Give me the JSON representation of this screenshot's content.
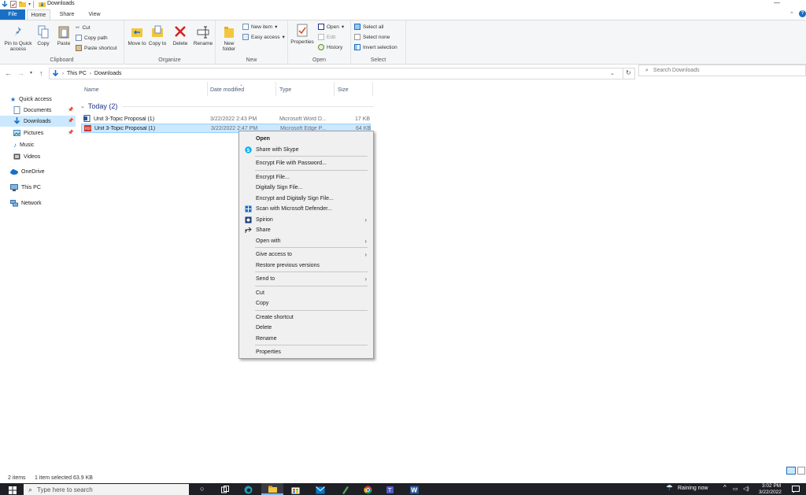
{
  "window": {
    "title": "Downloads",
    "tabs": [
      "File",
      "Home",
      "Share",
      "View"
    ],
    "active_tab": "Home"
  },
  "ribbon": {
    "clipboard": {
      "pin_label": "Pin to Quick access",
      "copy_label": "Copy",
      "paste_label": "Paste",
      "cut_label": "Cut",
      "copy_path_label": "Copy path",
      "paste_shortcut_label": "Paste shortcut",
      "group_label": "Clipboard"
    },
    "organize": {
      "move_to_label": "Move to",
      "copy_to_label": "Copy to",
      "delete_label": "Delete",
      "rename_label": "Rename",
      "group_label": "Organize"
    },
    "new": {
      "new_folder_label": "New folder",
      "new_item_label": "New item",
      "easy_access_label": "Easy access",
      "group_label": "New"
    },
    "open": {
      "properties_label": "Properties",
      "open_label": "Open",
      "edit_label": "Edit",
      "history_label": "History",
      "group_label": "Open"
    },
    "select": {
      "select_all_label": "Select all",
      "select_none_label": "Select none",
      "invert_selection_label": "Invert selection",
      "group_label": "Select"
    }
  },
  "address": {
    "crumbs": [
      "This PC",
      "Downloads"
    ],
    "search_placeholder": "Search Downloads"
  },
  "nav": {
    "quick_access": "Quick access",
    "items": [
      {
        "label": "Documents",
        "pinned": true
      },
      {
        "label": "Downloads",
        "pinned": true
      },
      {
        "label": "Pictures",
        "pinned": true
      },
      {
        "label": "Music",
        "pinned": false
      },
      {
        "label": "Videos",
        "pinned": false
      }
    ],
    "onedrive": "OneDrive",
    "this_pc": "This PC",
    "network": "Network"
  },
  "file_list": {
    "columns": [
      "Name",
      "Date modified",
      "Type",
      "Size"
    ],
    "group_label": "Today (2)",
    "rows": [
      {
        "name": "Unit 3-Topic Proposal (1)",
        "date": "3/22/2022 2:43 PM",
        "type": "Microsoft Word D...",
        "size": "17 KB"
      },
      {
        "name": "Unit 3-Topic Proposal (1)",
        "date": "3/22/2022 2:47 PM",
        "type": "Microsoft Edge P...",
        "size": "64 KB"
      }
    ]
  },
  "context_menu": {
    "items": [
      {
        "label": "Open",
        "bold": true
      },
      {
        "label": "Share with Skype",
        "icon": "skype-icon"
      },
      {
        "sep": true
      },
      {
        "label": "Encrypt File with Password..."
      },
      {
        "sep": true
      },
      {
        "label": "Encrypt File..."
      },
      {
        "label": "Digitally Sign File..."
      },
      {
        "label": "Encrypt and Digitally Sign File..."
      },
      {
        "label": "Scan with Microsoft Defender...",
        "icon": "defender-icon"
      },
      {
        "label": "Spirion",
        "icon": "spirion-icon",
        "submenu": true
      },
      {
        "label": "Share",
        "icon": "share-icon"
      },
      {
        "label": "Open with",
        "submenu": true
      },
      {
        "sep": true
      },
      {
        "label": "Give access to",
        "submenu": true
      },
      {
        "label": "Restore previous versions"
      },
      {
        "sep": true
      },
      {
        "label": "Send to",
        "submenu": true
      },
      {
        "sep": true
      },
      {
        "label": "Cut"
      },
      {
        "label": "Copy"
      },
      {
        "sep": true
      },
      {
        "label": "Create shortcut"
      },
      {
        "label": "Delete"
      },
      {
        "label": "Rename"
      },
      {
        "sep": true
      },
      {
        "label": "Properties"
      }
    ]
  },
  "status": {
    "item_count": "2 items",
    "selected": "1 item selected  63.9 KB"
  },
  "taskbar": {
    "search_placeholder": "Type here to search",
    "weather": "Raining now",
    "time": "3:02 PM",
    "date": "3/22/2022"
  },
  "colors": {
    "accent": "#1a6fc4",
    "selection": "#cce8ff",
    "taskbar": "#1f1f26"
  }
}
